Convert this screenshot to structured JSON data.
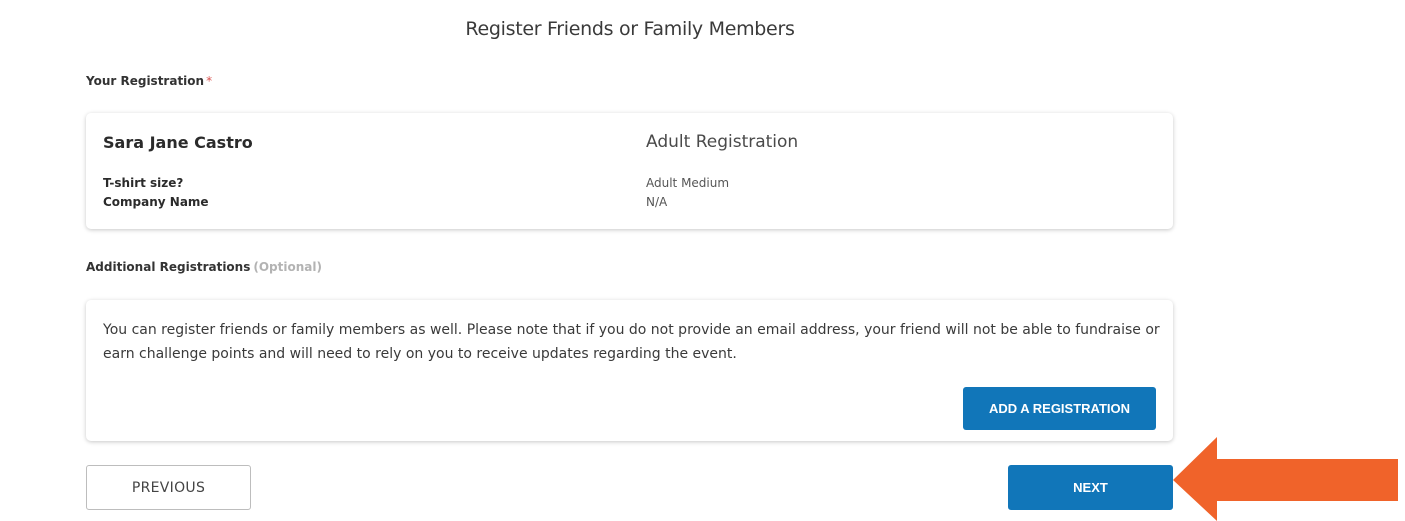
{
  "page": {
    "title": "Register Friends or Family Members"
  },
  "your_registration": {
    "label": "Your Registration",
    "required_mark": "*",
    "name": "Sara Jane Castro",
    "type": "Adult Registration",
    "fields": [
      {
        "label": "T-shirt size?",
        "value": "Adult Medium"
      },
      {
        "label": "Company Name",
        "value": "N/A"
      }
    ]
  },
  "additional_registrations": {
    "label": "Additional Registrations",
    "optional_tag": "(Optional)",
    "description": "You can register friends or family members as well. Please note that if you do not provide an email address, your friend will not be able to fundraise or earn challenge points and will need to rely on you to receive updates regarding the event.",
    "add_button_label": "ADD A REGISTRATION"
  },
  "nav": {
    "previous_label": "PREVIOUS",
    "next_label": "NEXT"
  },
  "colors": {
    "primary": "#1176b9",
    "annotation_arrow": "#f0632a",
    "required": "#d9534f"
  },
  "icons": {
    "annotation": "arrow-left-icon"
  }
}
